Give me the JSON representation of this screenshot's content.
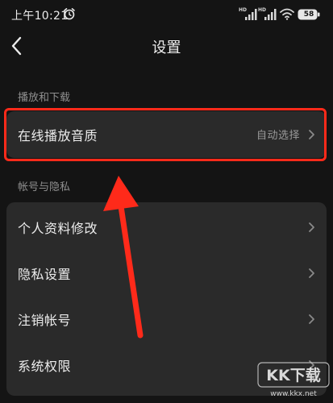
{
  "status_bar": {
    "time": "上午10:21",
    "network_labels": [
      "HD",
      "HD"
    ],
    "battery": "58"
  },
  "header": {
    "title": "设置"
  },
  "sections": [
    {
      "header": "播放和下载",
      "rows": [
        {
          "label": "在线播放音质",
          "value": "自动选择"
        }
      ]
    },
    {
      "header": "帐号与隐私",
      "rows": [
        {
          "label": "个人资料修改"
        },
        {
          "label": "隐私设置"
        },
        {
          "label": "注销帐号"
        },
        {
          "label": "系统权限"
        }
      ]
    }
  ],
  "annotation": {
    "color": "#ff2a1a"
  },
  "watermark": {
    "logo_text": "KK下载",
    "url": "www.kkx.net"
  },
  "colors": {
    "background": "#141414",
    "card": "#2a2a2a",
    "section_header": "#8f8f8f",
    "row_text": "#ececec",
    "row_value": "#9a9a9a"
  }
}
